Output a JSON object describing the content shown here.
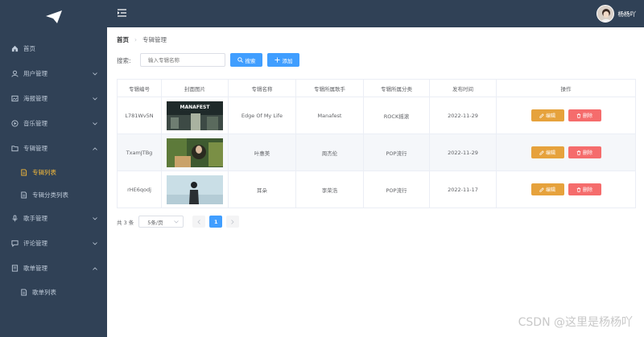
{
  "sidebar": {
    "items": [
      {
        "label": "首页",
        "icon": "home-icon"
      },
      {
        "label": "用户管理",
        "icon": "user-icon"
      },
      {
        "label": "海报管理",
        "icon": "poster-icon"
      },
      {
        "label": "音乐管理",
        "icon": "music-icon"
      },
      {
        "label": "专辑管理",
        "icon": "folder-icon"
      },
      {
        "label": "专辑列表",
        "icon": "list-icon"
      },
      {
        "label": "专辑分类列表",
        "icon": "document-icon"
      },
      {
        "label": "歌手管理",
        "icon": "microphone-icon"
      },
      {
        "label": "评论管理",
        "icon": "comment-icon"
      },
      {
        "label": "歌单管理",
        "icon": "playlist-icon"
      },
      {
        "label": "歌单列表",
        "icon": "document-icon"
      }
    ]
  },
  "header": {
    "username": "杨杨吖"
  },
  "breadcrumb": {
    "home": "首页",
    "current": "专辑管理"
  },
  "search": {
    "label": "搜索:",
    "placeholder": "输入专辑名称",
    "search_label": "搜索",
    "add_label": "添加"
  },
  "table": {
    "headers": [
      "专辑编号",
      "封面图片",
      "专辑名称",
      "专辑所属歌手",
      "专辑所属分类",
      "发布时间",
      "操作"
    ],
    "rows": [
      {
        "id": "L781Wv5N",
        "cover_text": "MANAFEST",
        "name": "Edge Of My Life",
        "singer": "Manafest",
        "category": "ROCK摇滚",
        "date": "2022-11-29"
      },
      {
        "id": "TxamJTBg",
        "cover_text": "",
        "name": "叶惠美",
        "singer": "周杰伦",
        "category": "POP流行",
        "date": "2022-11-29"
      },
      {
        "id": "rHE6qodj",
        "cover_text": "",
        "name": "耳朵",
        "singer": "李荣浩",
        "category": "POP流行",
        "date": "2022-11-17"
      }
    ],
    "edit_label": "编辑",
    "delete_label": "删除"
  },
  "pagination": {
    "total": "共 3 条",
    "page_size": "5条/页",
    "current_page": "1"
  },
  "watermark": "CSDN @这里是杨杨吖",
  "colors": {
    "sidebar_bg": "#304156",
    "active": "#f7bb3a",
    "primary": "#409eff",
    "warning": "#e6a23c",
    "danger": "#f56c6c"
  }
}
